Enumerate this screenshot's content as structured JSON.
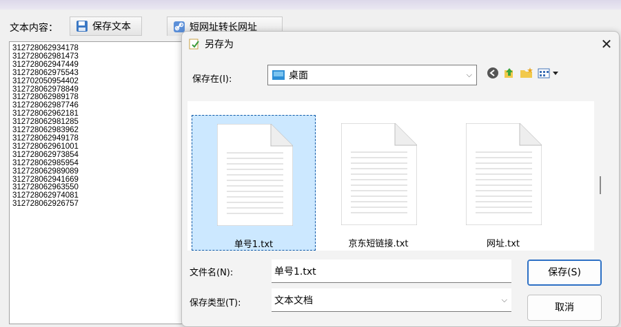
{
  "main": {
    "content_label": "文本内容：",
    "save_text_button": "保存文本",
    "short_to_long_button": "短网址转长网址",
    "lines": [
      "312728062934178",
      "312728062981473",
      "312728062947449",
      "312728062975543",
      "312702050954402",
      "312728062978849",
      "312728062989178",
      "312728062987746",
      "312728062962181",
      "312728062981285",
      "312728062983962",
      "312728062949178",
      "312728062961001",
      "312728062973854",
      "312728062985954",
      "312728062989089",
      "312728062941669",
      "312728062963550",
      "312728062974081",
      "312728062926757"
    ]
  },
  "dialog": {
    "title": "另存为",
    "save_in_label": "保存在(I):",
    "save_in_value": "桌面",
    "files": [
      {
        "name": "单号1.txt",
        "selected": true
      },
      {
        "name": "京东短链接.txt",
        "selected": false
      },
      {
        "name": "网址.txt",
        "selected": false
      }
    ],
    "filename_label": "文件名(N):",
    "filename_value": "单号1.txt",
    "filetype_label": "保存类型(T):",
    "filetype_value": "文本文档",
    "save_button": "保存(S)",
    "cancel_button": "取消"
  },
  "colors": {
    "selection": "#cce8ff",
    "accent": "#2b6fc4"
  }
}
